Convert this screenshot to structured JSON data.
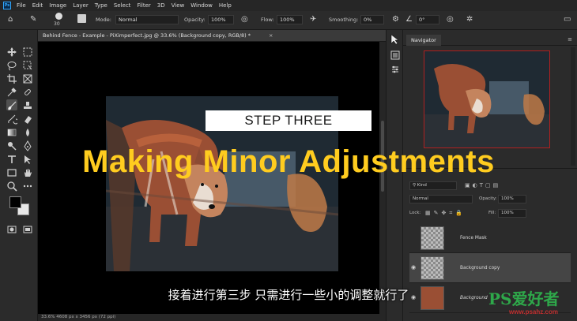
{
  "menu": {
    "logo": "Ps",
    "items": [
      "File",
      "Edit",
      "Image",
      "Layer",
      "Type",
      "Select",
      "Filter",
      "3D",
      "View",
      "Window",
      "Help"
    ]
  },
  "options_bar": {
    "brush_size": "30",
    "mode_label": "Mode:",
    "mode_value": "Normal",
    "opacity_label": "Opacity:",
    "opacity_value": "100%",
    "flow_label": "Flow:",
    "flow_value": "100%",
    "smoothing_label": "Smoothing:",
    "smoothing_value": "0%",
    "angle_value": "0°"
  },
  "document": {
    "tab_title": "Behind Fence - Example - PiXimperfect.jpg @ 33.6% (Background copy, RGB/8) *",
    "close_glyph": "×",
    "status": "33.6%    4608 px x 3456 px (72 ppi)"
  },
  "navigator": {
    "tab_label": "Navigator"
  },
  "layers": {
    "filter_kind": "Kind",
    "blend_mode": "Normal",
    "opacity_label": "Opacity:",
    "opacity_value": "100%",
    "lock_label": "Lock:",
    "fill_label": "Fill:",
    "fill_value": "100%",
    "items": [
      {
        "name": "Fence Mask",
        "visible": false,
        "selected": false
      },
      {
        "name": "Background copy",
        "visible": true,
        "selected": true
      },
      {
        "name": "Background",
        "visible": true,
        "selected": false
      }
    ]
  },
  "overlay": {
    "step_label": "STEP THREE",
    "title": "Making Minor Adjustments",
    "subtitle": "接着进行第三步 只需进行一些小的调整就行了",
    "watermark_logo": "PS爱好者",
    "watermark_url": "www.psahz.com"
  },
  "colors": {
    "title_yellow": "#ffcc1f",
    "watermark_green": "#2ea84a",
    "watermark_red": "#c03030",
    "selection_red": "#b02020"
  }
}
